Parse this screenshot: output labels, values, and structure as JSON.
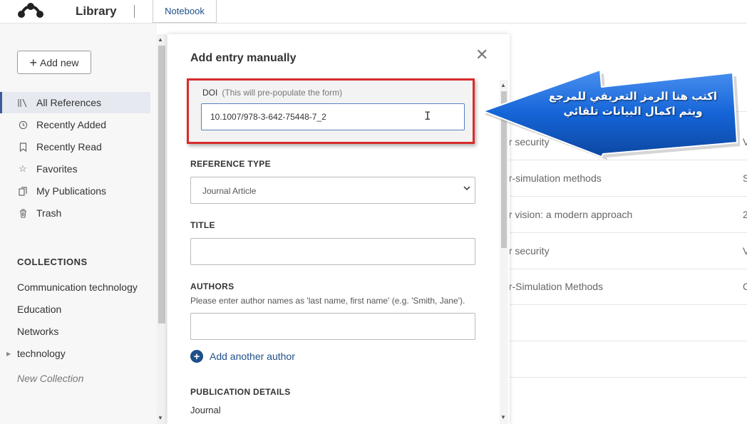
{
  "header": {
    "app_title": "Library",
    "tabs": [
      {
        "label": "Notebook"
      }
    ]
  },
  "sidebar": {
    "add_new_label": "Add new",
    "nav": [
      {
        "label": "All References",
        "icon": "library-icon",
        "active": true
      },
      {
        "label": "Recently Added",
        "icon": "clock-icon"
      },
      {
        "label": "Recently Read",
        "icon": "bookmark-icon"
      },
      {
        "label": "Favorites",
        "icon": "star-icon"
      },
      {
        "label": "My Publications",
        "icon": "publications-icon"
      },
      {
        "label": "Trash",
        "icon": "trash-icon"
      }
    ],
    "collections_heading": "COLLECTIONS",
    "collections": [
      "Communication technology",
      "Education",
      "Networks",
      "technology"
    ],
    "new_collection_label": "New Collection"
  },
  "background_list": {
    "rows": [
      {
        "title": "er security",
        "trail": "V"
      },
      {
        "title": "er-simulation methods",
        "trail": "S"
      },
      {
        "title": "er vision: a modern approach",
        "trail": "2"
      },
      {
        "title": "er security",
        "trail": "V"
      },
      {
        "title": "er-Simulation Methods",
        "trail": "C"
      }
    ]
  },
  "modal": {
    "title": "Add entry manually",
    "close_glyph": "✕",
    "doi": {
      "label": "DOI",
      "hint": "(This will pre-populate the form)",
      "value": "10.1007/978-3-642-75448-7_2"
    },
    "reference_type": {
      "label": "REFERENCE TYPE",
      "value": "Journal Article"
    },
    "title_field": {
      "label": "TITLE",
      "value": ""
    },
    "authors": {
      "label": "AUTHORS",
      "help": "Please enter author names as 'last name, first name' (e.g. 'Smith, Jane').",
      "value": ""
    },
    "add_author_label": "Add another author",
    "publication_details_label": "PUBLICATION DETAILS",
    "journal_label": "Journal"
  },
  "annotation": {
    "line1": "اكتب هنا الرمز التعريفي للمرجع",
    "line2": "ويتم اكمال البيانات تلقائي",
    "fill_color": "#1565d8",
    "highlight_color": "#d92b2b"
  }
}
